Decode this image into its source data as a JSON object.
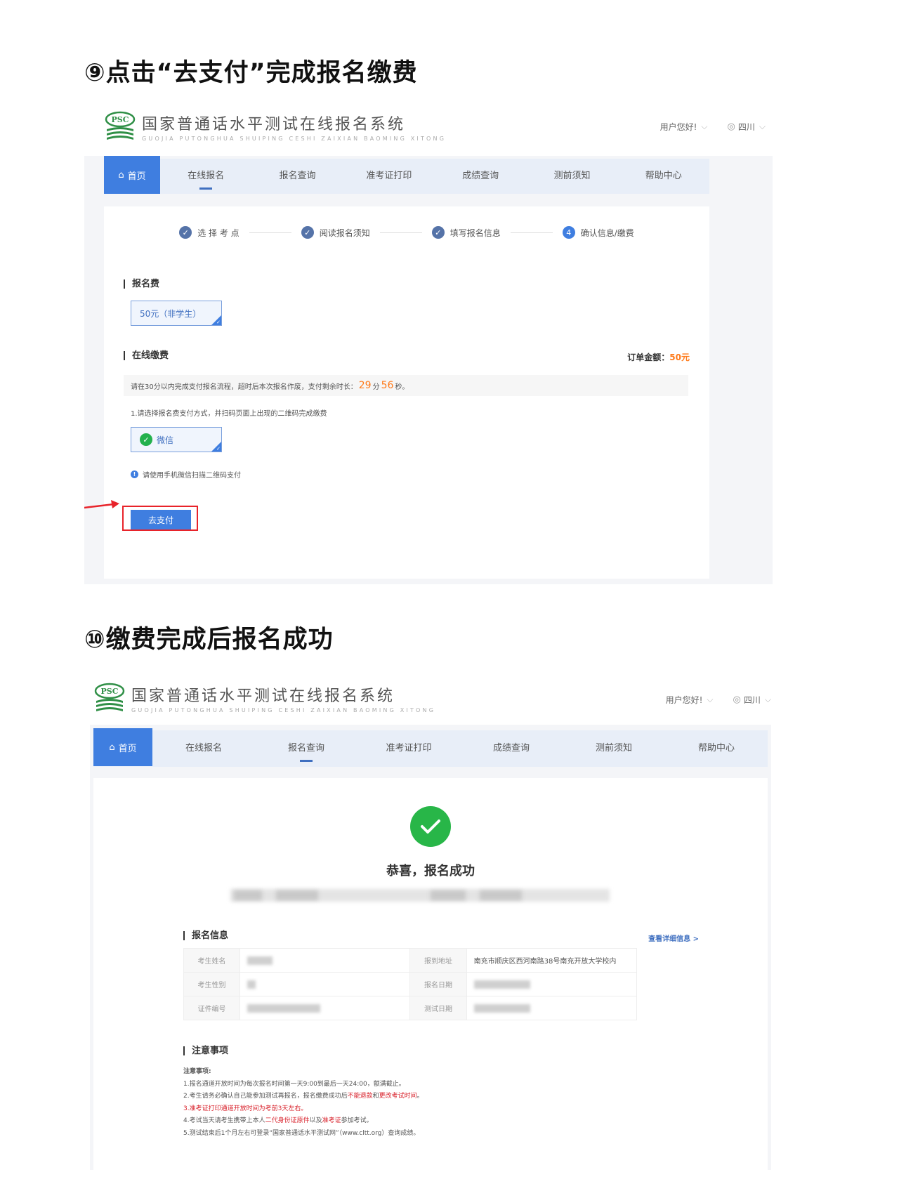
{
  "step9": {
    "heading": "⑨点击“去支付”完成报名缴费"
  },
  "step10": {
    "heading": "⑩缴费完成后报名成功"
  },
  "header": {
    "logo_badge": "PSC",
    "title": "国家普通话水平测试在线报名系统",
    "subtitle": "GUOJIA PUTONGHUA SHUIPING CESHI ZAIXIAN BAOMING XITONG",
    "greeting": "用户您好!",
    "region": "四川"
  },
  "nav": {
    "home": "首页",
    "items": [
      "在线报名",
      "报名查询",
      "准考证打印",
      "成绩查询",
      "测前须知",
      "帮助中心"
    ]
  },
  "progress": {
    "steps": [
      "选 择 考 点",
      "阅读报名须知",
      "填写报名信息",
      "确认信息/缴费"
    ],
    "current_number": "4"
  },
  "payment": {
    "fee_section": "报名费",
    "fee_option": "50元（非学生）",
    "online_section": "在线缴费",
    "order_label": "订单金额：",
    "order_amount": "50元",
    "timer_prefix": "请在30分以内完成支付报名流程，超时后本次报名作废，支付剩余时长：",
    "timer_min": "29",
    "timer_min_unit": "分",
    "timer_sec": "56",
    "timer_sec_unit": "秒。",
    "instruction": "1.请选择报名费支付方式，并扫码页面上出现的二维码完成缴费",
    "method": "微信",
    "scan_tip": "请使用手机微信扫描二维码支付",
    "pay_button": "去支付"
  },
  "success": {
    "message": "恭喜，报名成功",
    "info_section": "报名信息",
    "detail_link": "查看详细信息 >",
    "rows": [
      {
        "l1": "考生姓名",
        "l2": "报到地址",
        "v2": "南充市顺庆区西河南路38号南充开放大学校内"
      },
      {
        "l1": "考生性别",
        "l2": "报名日期"
      },
      {
        "l1": "证件编号",
        "l2": "测试日期"
      }
    ],
    "notice_section": "注意事项",
    "notice_title": "注意事项:",
    "notices": [
      {
        "plain": "1.报名通道开放时间为每次报名时间第一天9:00到最后一天24:00，额满截止。"
      },
      {
        "a": "2.考生请务必确认自己能参加测试再报名，报名缴费成功后",
        "red": "不能退款",
        "b": "和",
        "red2": "更改考试时间",
        "c": "。"
      },
      {
        "redline": "3.准考证打印通道开放时间为考前3天左右。"
      },
      {
        "a": "4.考试当天请考生携带上本人",
        "red": "二代身份证原件",
        "b": "以及",
        "red2": "准考证",
        "c": "参加考试。"
      },
      {
        "plain": "5.测试结束后1个月左右可登录“国家普通话水平测试网”（www.cltt.org）查询成绩。"
      }
    ]
  },
  "colors": {
    "accent": "#3f7ee0",
    "highlight": "#e8232a",
    "success": "#28b648",
    "amount": "#ff7a1a"
  }
}
